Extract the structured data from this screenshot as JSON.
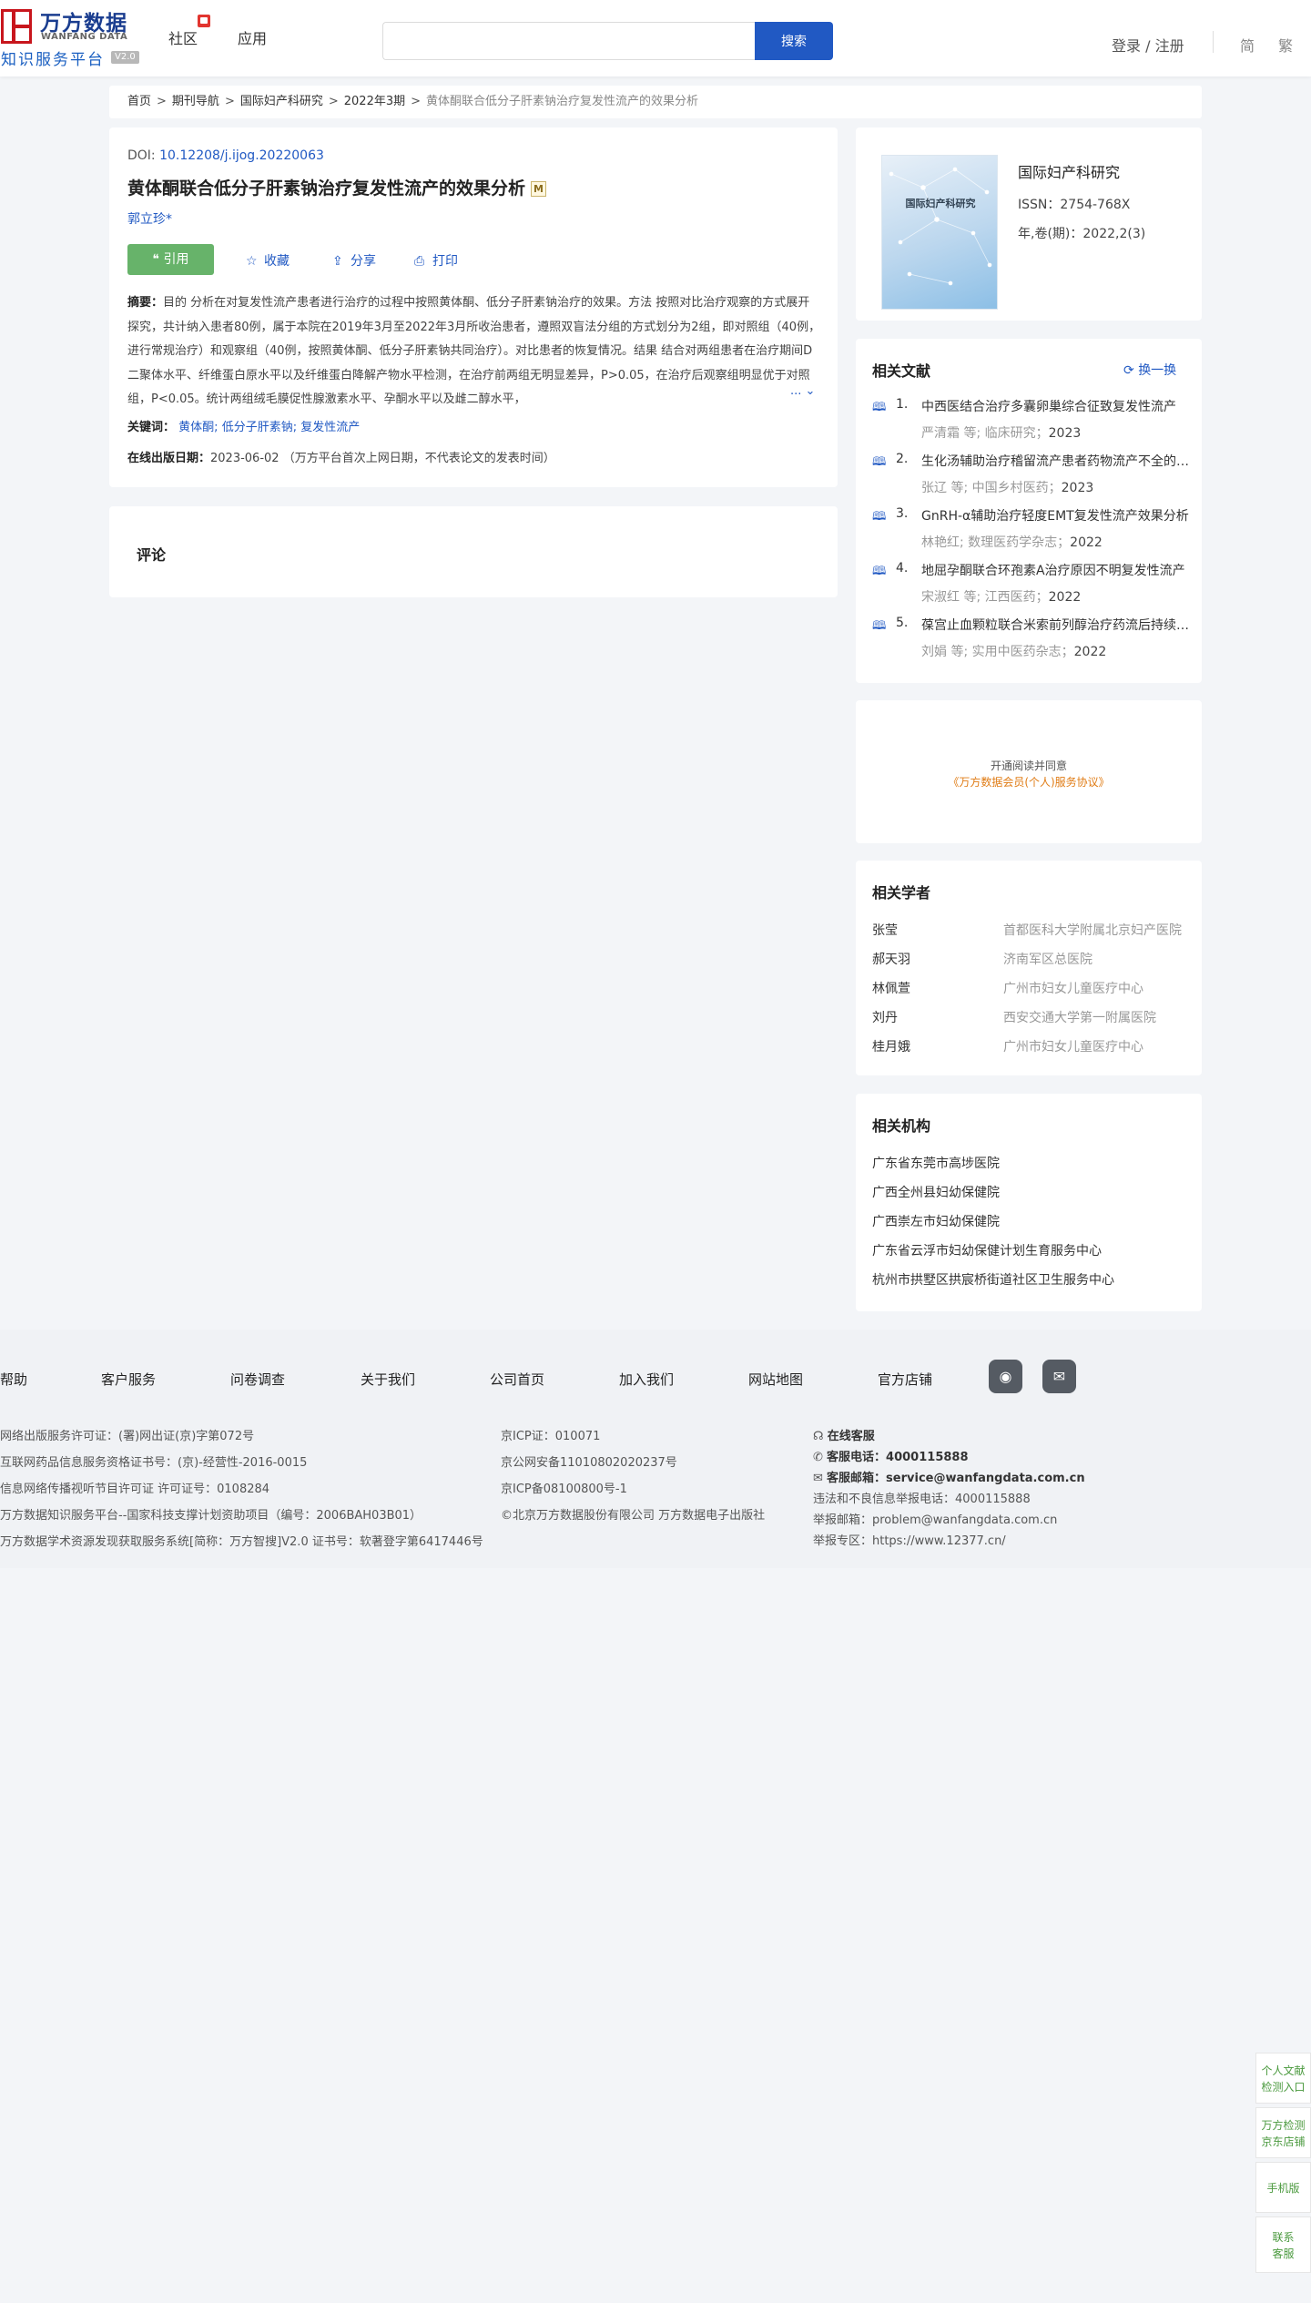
{
  "header": {
    "logo_cn": "万方数据",
    "logo_en": "WANFANG DATA",
    "logo_sub": "知识服务平台",
    "logo_version": "V2.0",
    "nav_community": "社区",
    "nav_apps": "应用",
    "search_placeholder": "",
    "search_button": "搜索",
    "login": "登录 / 注册",
    "lang_simplified": "简",
    "lang_traditional": "繁"
  },
  "breadcrumb": [
    "首页",
    "期刊导航",
    "国际妇产科研究",
    "2022年3期",
    "黄体酮联合低分子肝素钠治疗复发性流产的效果分析"
  ],
  "article": {
    "doi_label": "DOI:",
    "doi": "10.12208/j.ijog.20220063",
    "title": "黄体酮联合低分子肝素钠治疗复发性流产的效果分析",
    "title_badge": "M",
    "author": "郭立珍*",
    "actions": {
      "cite": "引用",
      "favorite": "收藏",
      "share": "分享",
      "print": "打印"
    },
    "abstract_label": "摘要：",
    "abstract": "目的 分析在对复发性流产患者进行治疗的过程中按照黄体酮、低分子肝素钠治疗的效果。方法 按照对比治疗观察的方式展开探究，共计纳入患者80例，属于本院在2019年3月至2022年3月所收治患者，遵照双盲法分组的方式划分为2组，即对照组（40例，进行常规治疗）和观察组（40例，按照黄体酮、低分子肝素钠共同治疗）。对比患者的恢复情况。结果 结合对两组患者在治疗期间D二聚体水平、纤维蛋白原水平以及纤维蛋白降解产物水平检测，在治疗前两组无明显差异，P>0.05，在治疗后观察组明显优于对照组，P<0.05。统计两组绒毛膜促性腺激素水平、孕酮水平以及雌二醇水平，",
    "abstract_more": "...",
    "keywords_label": "关键词：",
    "keywords": [
      "黄体酮;",
      "低分子肝素钠;",
      "复发性流产"
    ],
    "pubdate_label": "在线出版日期：",
    "pubdate": "2023-06-02",
    "pubdate_note": "（万方平台首次上网日期，不代表论文的发表时间）"
  },
  "comments": {
    "title": "评论"
  },
  "journal": {
    "cover_title": "国际妇产科研究",
    "name": "国际妇产科研究",
    "issn": "ISSN：2754-768X",
    "volume": "年,卷(期)：2022,2(3)"
  },
  "related_docs": {
    "title": "相关文献",
    "swap": "换一换",
    "items": [
      {
        "num": "1.",
        "title": "中西医结合治疗多囊卵巢综合征致复发性流产",
        "source": "严清霜  等;  临床研究；",
        "year": "2023"
      },
      {
        "num": "2.",
        "title": "生化汤辅助治疗稽留流产患者药物流产不全的效果",
        "source": "张辽  等;  中国乡村医药；",
        "year": "2023"
      },
      {
        "num": "3.",
        "title": "GnRH-α辅助治疗轻度EMT复发性流产效果分析",
        "source": "林艳红; 数理医药学杂志；",
        "year": "2022"
      },
      {
        "num": "4.",
        "title": "地屈孕酮联合环孢素A治疗原因不明复发性流产",
        "source": "宋淑红  等;  江西医药；",
        "year": "2022"
      },
      {
        "num": "5.",
        "title": "葆宫止血颗粒联合米索前列醇治疗药流后持续出血",
        "source": "刘娟  等;  实用中医药杂志；",
        "year": "2022"
      }
    ]
  },
  "protocol": {
    "line1": "开通阅读并同意",
    "line2": "《万方数据会员(个人)服务协议》"
  },
  "scholars": {
    "title": "相关学者",
    "items": [
      {
        "name": "张莹",
        "org": "首都医科大学附属北京妇产医院"
      },
      {
        "name": "郝天羽",
        "org": "济南军区总医院"
      },
      {
        "name": "林佩萱",
        "org": "广州市妇女儿童医疗中心"
      },
      {
        "name": "刘丹",
        "org": "西安交通大学第一附属医院"
      },
      {
        "name": "桂月娥",
        "org": "广州市妇女儿童医疗中心"
      }
    ]
  },
  "institutions": {
    "title": "相关机构",
    "items": [
      "广东省东莞市高埗医院",
      "广西全州县妇幼保健院",
      "广西崇左市妇幼保健院",
      "广东省云浮市妇幼保健计划生育服务中心",
      "杭州市拱墅区拱宸桥街道社区卫生服务中心"
    ]
  },
  "footer": {
    "links": [
      "帮助",
      "客户服务",
      "问卷调查",
      "关于我们",
      "公司首页",
      "加入我们",
      "网站地图",
      "官方店铺"
    ],
    "col1": [
      "网络出版服务许可证：(署)网出证(京)字第072号",
      "互联网药品信息服务资格证书号：(京)-经营性-2016-0015",
      "信息网络传播视听节目许可证 许可证号：0108284",
      "万方数据知识服务平台--国家科技支撑计划资助项目（编号：2006BAH03B01）",
      "万方数据学术资源发现获取服务系统[简称：万方智搜]V2.0 证书号：软著登字第6417446号"
    ],
    "col2": [
      "京ICP证：010071",
      "京公网安备11010802020237号",
      "京ICP备08100800号-1",
      "©北京万方数据股份有限公司 万方数据电子出版社"
    ],
    "col3_online": "在线客服",
    "col3_phone_label": "客服电话：",
    "col3_phone": "4000115888",
    "col3_email_label": "客服邮箱：",
    "col3_email": "service@wanfangdata.com.cn",
    "col3_report_phone": "违法和不良信息举报电话：4000115888",
    "col3_report_email": "举报邮箱：problem@wanfangdata.com.cn",
    "col3_report_zone": "举报专区：https://www.12377.cn/"
  },
  "side": {
    "b1": "个人文献检测入口",
    "b2": "万方检测京东店铺",
    "b3": "手机版",
    "b4": "联系客服"
  }
}
